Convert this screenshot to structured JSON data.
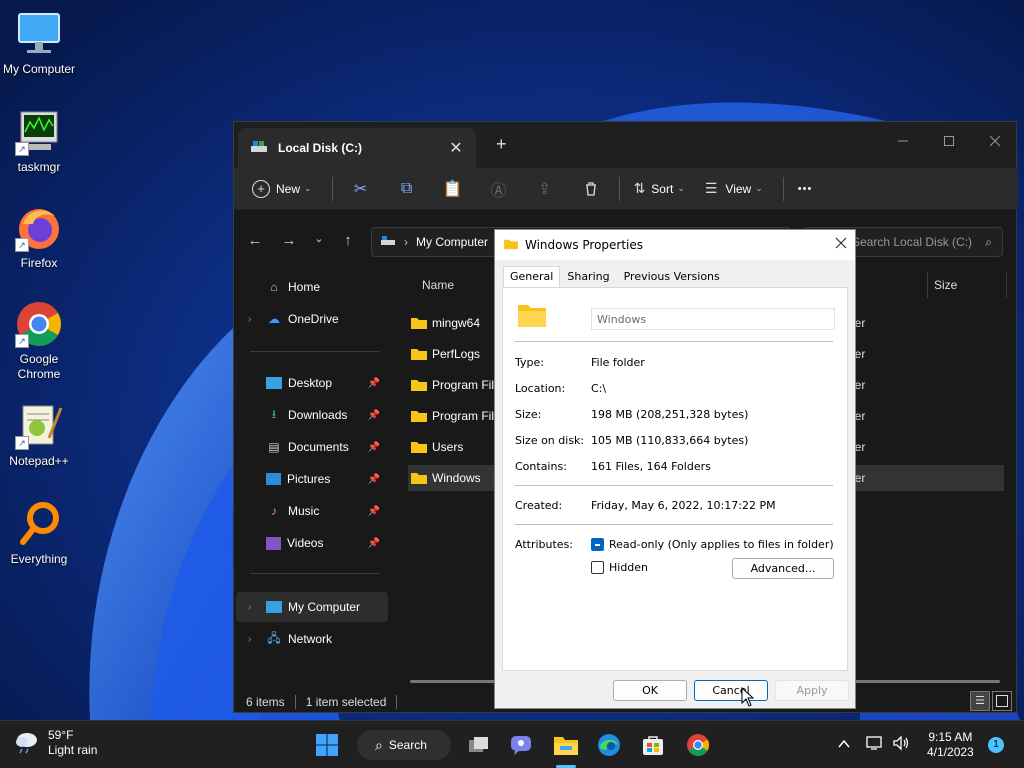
{
  "desktop": {
    "icons": [
      {
        "label": "My Computer"
      },
      {
        "label": "taskmgr"
      },
      {
        "label": "Firefox"
      },
      {
        "label": "Google Chrome"
      },
      {
        "label": "Notepad++"
      },
      {
        "label": "Everything"
      }
    ]
  },
  "explorer": {
    "tab_title": "Local Disk (C:)",
    "tab_close": "✕",
    "new_tab": "+",
    "toolbar": {
      "new_label": "New",
      "sort_label": "Sort",
      "view_label": "View",
      "more_label": "•••"
    },
    "address": {
      "crumb": "My Computer",
      "search_placeholder": "Search Local Disk (C:)"
    },
    "nav": {
      "items": [
        {
          "label": "Home"
        },
        {
          "label": "OneDrive"
        },
        {
          "label": "Desktop"
        },
        {
          "label": "Downloads"
        },
        {
          "label": "Documents"
        },
        {
          "label": "Pictures"
        },
        {
          "label": "Music"
        },
        {
          "label": "Videos"
        },
        {
          "label": "My Computer"
        },
        {
          "label": "Network"
        }
      ]
    },
    "columns": {
      "name": "Name",
      "size": "Size"
    },
    "files": [
      {
        "name": "mingw64",
        "type_tail": "ler"
      },
      {
        "name": "PerfLogs",
        "type_tail": "ler"
      },
      {
        "name": "Program Files",
        "type_tail": "ler"
      },
      {
        "name": "Program Files (x86)",
        "type_tail": "ler"
      },
      {
        "name": "Users",
        "type_tail": "ler"
      },
      {
        "name": "Windows",
        "type_tail": "ler"
      }
    ],
    "status": {
      "count": "6 items",
      "selection": "1 item selected"
    }
  },
  "dialog": {
    "title": "Windows Properties",
    "tabs": [
      "General",
      "Sharing",
      "Previous Versions"
    ],
    "folder_name": "Windows",
    "props": {
      "type_label": "Type:",
      "type_value": "File folder",
      "location_label": "Location:",
      "location_value": "C:\\",
      "size_label": "Size:",
      "size_value": "198 MB (208,251,328 bytes)",
      "sod_label": "Size on disk:",
      "sod_value": "105 MB (110,833,664 bytes)",
      "contains_label": "Contains:",
      "contains_value": "161 Files, 164 Folders",
      "created_label": "Created:",
      "created_value": "Friday, May 6, 2022, 10:17:22 PM",
      "attributes_label": "Attributes:"
    },
    "attrs": {
      "readonly_label": "Read-only (Only applies to files in folder)",
      "hidden_label": "Hidden",
      "advanced_label": "Advanced..."
    },
    "buttons": {
      "ok": "OK",
      "cancel": "Cancel",
      "apply": "Apply"
    }
  },
  "taskbar": {
    "weather_temp": "59°F",
    "weather_desc": "Light rain",
    "search_label": "Search",
    "time": "9:15 AM",
    "date": "4/1/2023",
    "notif_count": "1"
  }
}
